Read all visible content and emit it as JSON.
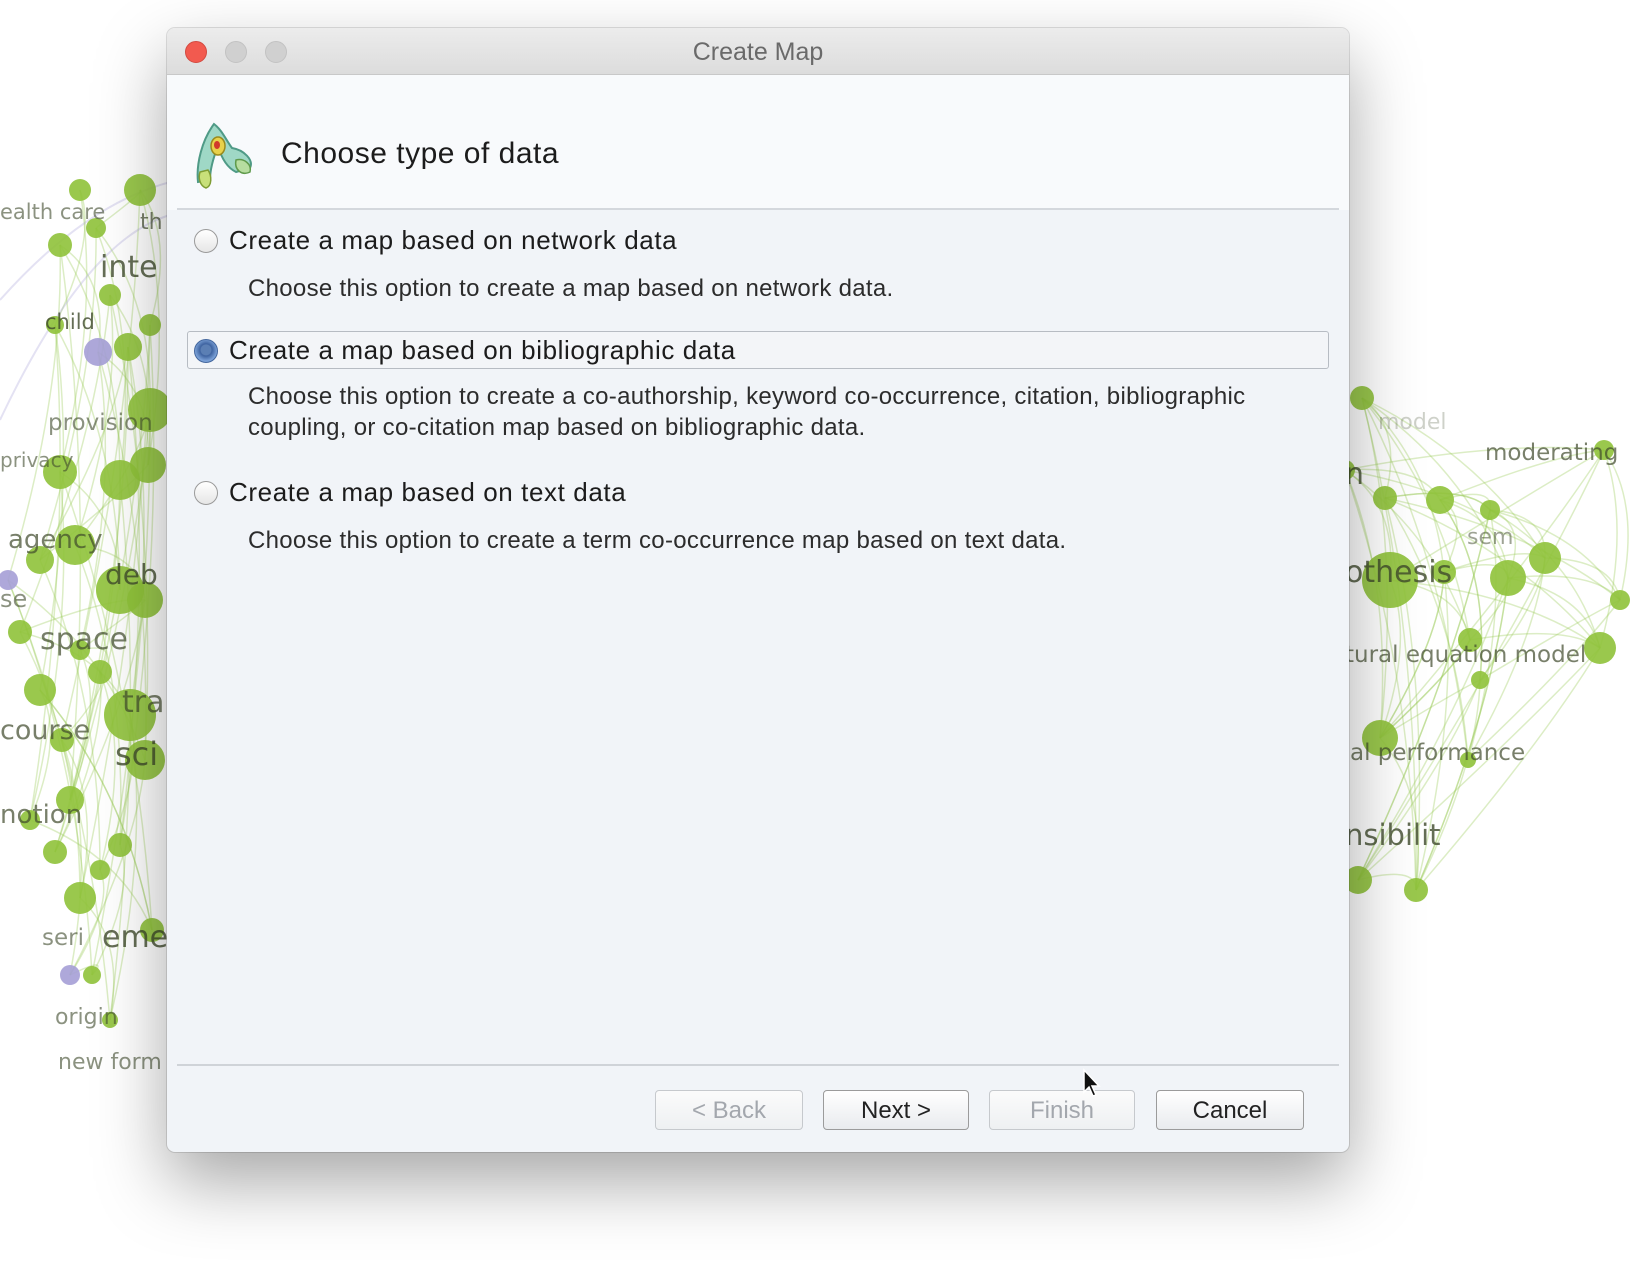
{
  "window": {
    "title": "Create Map"
  },
  "header": {
    "title": "Choose type of data"
  },
  "options": [
    {
      "label": "Create a map based on network data",
      "description": [
        "Choose this option to create a map based on network data."
      ],
      "selected": false
    },
    {
      "label": "Create a map based on bibliographic data",
      "description": [
        "Choose this option to create a co-authorship, keyword co-occurrence, citation, bibliographic",
        "coupling, or co-citation map based on bibliographic data."
      ],
      "selected": true
    },
    {
      "label": "Create a map based on text data",
      "description": [
        "Choose this option to create a term co-occurrence map based on text data."
      ],
      "selected": false
    }
  ],
  "buttons": {
    "back": {
      "label": "< Back",
      "enabled": false
    },
    "next": {
      "label": "Next >",
      "enabled": true
    },
    "finish": {
      "label": "Finish",
      "enabled": false
    },
    "cancel": {
      "label": "Cancel",
      "enabled": true
    }
  },
  "background_labels": [
    "ealth care",
    "th",
    "inte",
    "child",
    "provision",
    "privacy",
    "agency",
    "deb",
    "se",
    "space",
    "tra",
    "course",
    "sci",
    "notion",
    "emer",
    "seri",
    "origin",
    "new form",
    "model",
    "moderating",
    "n",
    "sem",
    "othesis",
    "tural equation model",
    "al performance",
    "nsibilit"
  ],
  "colors": {
    "node_green": "#8fc23a",
    "node_purple": "#a59ed6",
    "edge_green": "#9ccb5a",
    "dialog_bg": "#f1f4f8",
    "close_button": "#f25a4f",
    "selected_radio": "#3e63a0"
  }
}
